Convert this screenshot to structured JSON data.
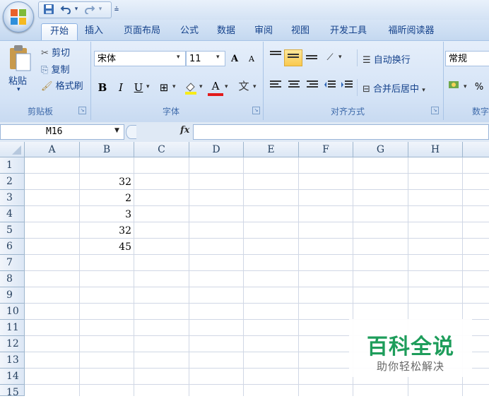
{
  "quick_access": {
    "save_icon": "save-icon",
    "undo_icon": "undo-icon",
    "redo_icon": "redo-icon",
    "customize": "▾"
  },
  "tabs": [
    {
      "label": "开始",
      "active": true
    },
    {
      "label": "插入"
    },
    {
      "label": "页面布局"
    },
    {
      "label": "公式"
    },
    {
      "label": "数据"
    },
    {
      "label": "审阅"
    },
    {
      "label": "视图"
    },
    {
      "label": "开发工具"
    },
    {
      "label": "福昕阅读器"
    }
  ],
  "ribbon": {
    "clipboard": {
      "paste": "粘贴",
      "cut": "剪切",
      "copy": "复制",
      "format_painter": "格式刷",
      "group_label": "剪贴板"
    },
    "font": {
      "font_name": "宋体",
      "font_size": "11",
      "bold": "B",
      "italic": "I",
      "underline": "U",
      "grow": "A",
      "shrink": "A",
      "font_color": "A",
      "phonetic": "文",
      "group_label": "字体"
    },
    "alignment": {
      "wrap_text": "自动换行",
      "merge_center": "合并后居中",
      "group_label": "对齐方式"
    },
    "number": {
      "format": "常规",
      "percent": "%",
      "group_label": "数字"
    }
  },
  "formula_bar": {
    "name_box": "M16",
    "fx": "fx",
    "formula": ""
  },
  "grid": {
    "columns": [
      "A",
      "B",
      "C",
      "D",
      "E",
      "F",
      "G",
      "H"
    ],
    "rows": [
      "1",
      "2",
      "3",
      "4",
      "5",
      "6",
      "7",
      "8",
      "9",
      "10",
      "11",
      "12",
      "13",
      "14",
      "15"
    ],
    "cells": {
      "B2": "32",
      "B3": "2",
      "B4": "3",
      "B5": "32",
      "B6": "45"
    }
  },
  "watermark": {
    "title": "百科全说",
    "subtitle": "助你轻松解决"
  },
  "colors": {
    "ribbon_bg": "#d4e3f6",
    "accent_text": "#15428b",
    "watermark_green": "#1e9d5b"
  }
}
